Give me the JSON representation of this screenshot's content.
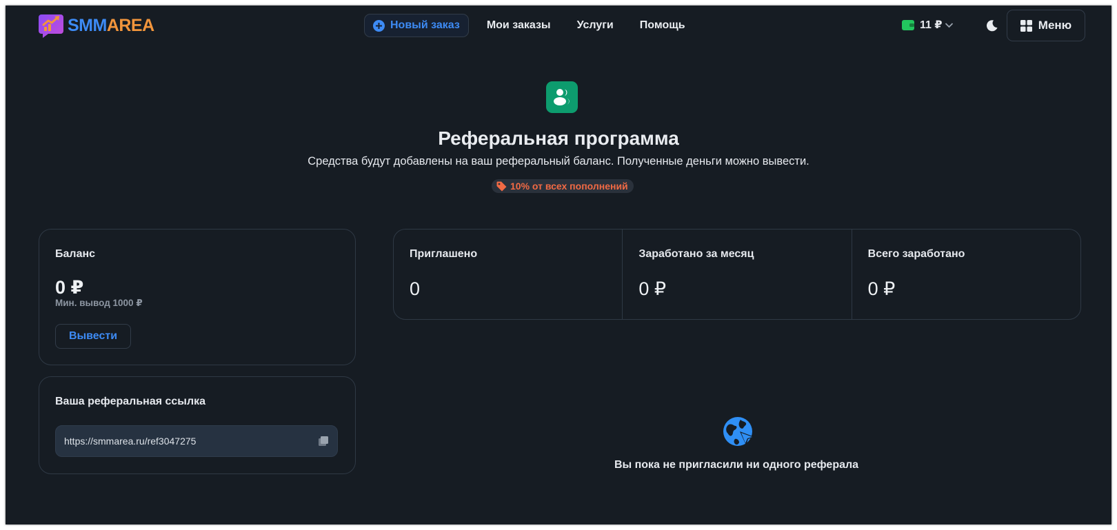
{
  "header": {
    "logo_part1": "SMM",
    "logo_part2": "AREA",
    "new_order_label": "Новый заказ",
    "nav": [
      "Мои заказы",
      "Услуги",
      "Помощь"
    ],
    "balance": "11 ₽",
    "menu_label": "Меню"
  },
  "hero": {
    "title": "Реферальная программа",
    "subtitle": "Средства будут добавлены на ваш реферальный баланс. Полученные деньги можно вывести.",
    "badge": "10% от всех пополнений"
  },
  "balance_card": {
    "label": "Баланс",
    "amount": "0 ₽",
    "min_withdraw": "Мин. вывод 1000 ₽",
    "withdraw_label": "Вывести"
  },
  "link_card": {
    "label": "Ваша реферальная ссылка",
    "url": "https://smmarea.ru/ref3047275"
  },
  "stats": [
    {
      "label": "Приглашено",
      "value": "0"
    },
    {
      "label": "Заработано за месяц",
      "value": "0 ₽"
    },
    {
      "label": "Всего заработано",
      "value": "0 ₽"
    }
  ],
  "empty_state": {
    "text": "Вы пока не пригласили ни одного реферала"
  },
  "colors": {
    "background": "#161c23",
    "accent_blue": "#3d8bf5",
    "accent_orange": "#f2953c",
    "hero_icon_green": "#0d9c6e",
    "badge_red": "#f26a44",
    "wallet_green": "#22c55e"
  },
  "icons": {
    "logo": "chart-up-logo-icon",
    "new_order": "plus-circle-icon",
    "wallet": "wallet-icon",
    "chevron": "chevron-down-icon",
    "theme": "moon-icon",
    "menu": "grid-icon",
    "hero": "users-icon",
    "tag": "tag-icon",
    "copy": "copy-icon",
    "empty": "globe-cursor-icon"
  }
}
